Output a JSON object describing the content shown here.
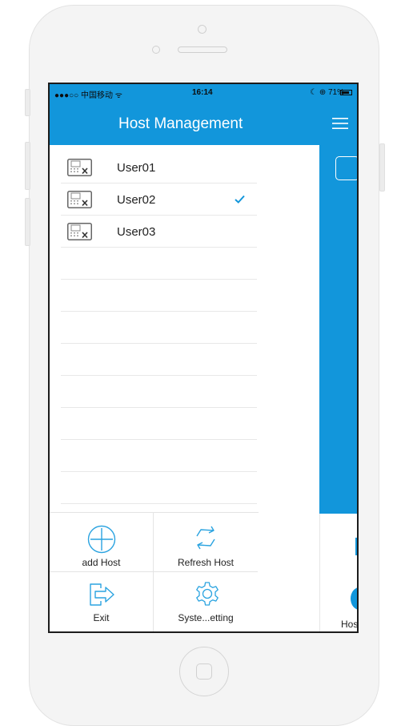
{
  "status_bar": {
    "carrier": "●●●○○ 中国移动 ᯤ",
    "time": "16:14",
    "battery": "☾ ⊕ 71%"
  },
  "nav": {
    "title": "Host Management"
  },
  "hosts": [
    {
      "name": "User01",
      "selected": false
    },
    {
      "name": "User02",
      "selected": true
    },
    {
      "name": "User03",
      "selected": false
    }
  ],
  "actions": {
    "add_host": "add Host",
    "refresh_host": "Refresh Host",
    "exit": "Exit",
    "system_setting": "Syste...etting"
  },
  "background_view": {
    "tab_label": "Hos"
  },
  "colors": {
    "accent": "#1296db",
    "icon": "#2aa3e0"
  }
}
